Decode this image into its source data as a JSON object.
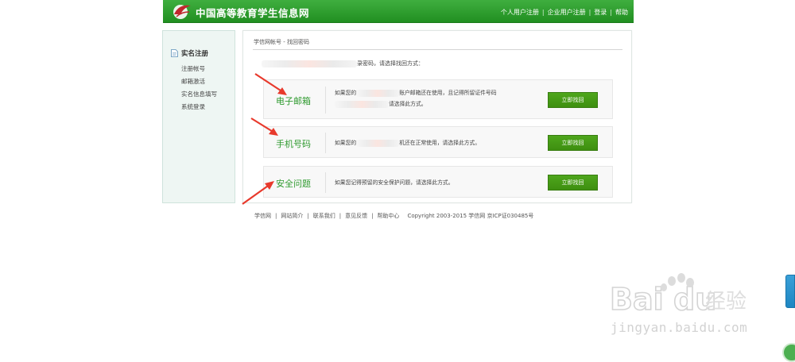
{
  "header": {
    "site_title": "中国高等教育学生信息网",
    "links": [
      "个人用户注册",
      "企业用户注册",
      "登录",
      "帮助"
    ]
  },
  "sidebar": {
    "heading": "实名注册",
    "items": [
      "注册帐号",
      "邮箱激活",
      "实名信息填写",
      "系统登录"
    ]
  },
  "breadcrumb": "学信网帐号 - 找回密码",
  "intro": {
    "suffix": "录密码，请选择找回方式："
  },
  "options": [
    {
      "title": "电子邮箱",
      "desc_line1_prefix": "如果您的",
      "desc_line1_suffix": "账户邮箱还在使用，且记得所留证件号码",
      "desc_line2": "请选择此方式。",
      "button": "立即找回"
    },
    {
      "title": "手机号码",
      "desc_prefix": "如果您的",
      "desc_suffix": "机还在正常使用，请选择此方式。",
      "button": "立即找回"
    },
    {
      "title": "安全问题",
      "desc": "如果您记得预留的安全保护问题，请选择此方式。",
      "button": "立即找回"
    }
  ],
  "footer": {
    "links": [
      "学信网",
      "网站简介",
      "联系我们",
      "意见反馈",
      "帮助中心"
    ],
    "copyright": "Copyright 2003-2015 学信网 京ICP证030485号"
  },
  "watermark": {
    "text": "jingyan.baidu.com"
  },
  "colors": {
    "header_green": "#2e9e2e",
    "button_green": "#459a16",
    "title_green": "#2f9a2f",
    "arrow_red": "#e8392c"
  }
}
